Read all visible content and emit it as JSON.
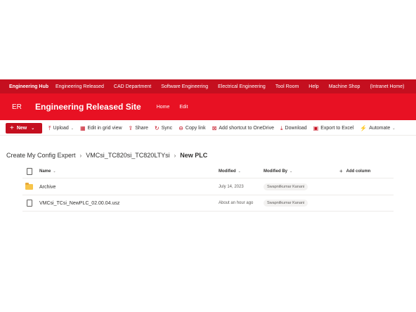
{
  "topnav": {
    "hub": "Engineering Hub",
    "items": [
      "Engineering Released",
      "CAD Department",
      "Software Engineering",
      "Electrical Engineering",
      "Tool Room",
      "Help",
      "Machine Shop",
      "(Intranet Home)"
    ]
  },
  "site": {
    "logo": "ER",
    "title": "Engineering Released Site",
    "nav": [
      "Home",
      "Edit"
    ]
  },
  "commands": {
    "new_label": "New",
    "items": [
      {
        "label": "Upload",
        "icon": "upload-icon",
        "glyph": "⤒",
        "dropdown": true
      },
      {
        "label": "Edit in grid view",
        "icon": "grid-icon",
        "glyph": "▦",
        "dropdown": false
      },
      {
        "label": "Share",
        "icon": "share-icon",
        "glyph": "⇪",
        "dropdown": false
      },
      {
        "label": "Sync",
        "icon": "sync-icon",
        "glyph": "↻",
        "dropdown": false
      },
      {
        "label": "Copy link",
        "icon": "link-icon",
        "glyph": "⊖",
        "dropdown": false
      },
      {
        "label": "Add shortcut to OneDrive",
        "icon": "shortcut-icon",
        "glyph": "⊠",
        "dropdown": false
      },
      {
        "label": "Download",
        "icon": "download-icon",
        "glyph": "⤓",
        "dropdown": false
      },
      {
        "label": "Export to Excel",
        "icon": "excel-icon",
        "glyph": "▣",
        "dropdown": false
      },
      {
        "label": "Automate",
        "icon": "automate-icon",
        "glyph": "⚡",
        "dropdown": true
      }
    ]
  },
  "breadcrumb": {
    "items": [
      "Create My Config Expert",
      "VMCsi_TC820si_TC820LTYsi"
    ],
    "current": "New PLC"
  },
  "list": {
    "headers": {
      "name": "Name",
      "modified": "Modified",
      "modified_by": "Modified By",
      "add_column": "Add column"
    },
    "rows": [
      {
        "type": "folder",
        "name": "Archive",
        "modified": "July 14, 2023",
        "modified_by": "Swapnilkumar Kanani"
      },
      {
        "type": "file",
        "name": "VMCsi_TCsi_NewPLC_02.00.04.usz",
        "modified": "About an hour ago",
        "modified_by": "Swapnilkumar Kanani"
      }
    ]
  },
  "colors": {
    "brand_dark": "#c50f1f",
    "brand": "#e81123"
  }
}
